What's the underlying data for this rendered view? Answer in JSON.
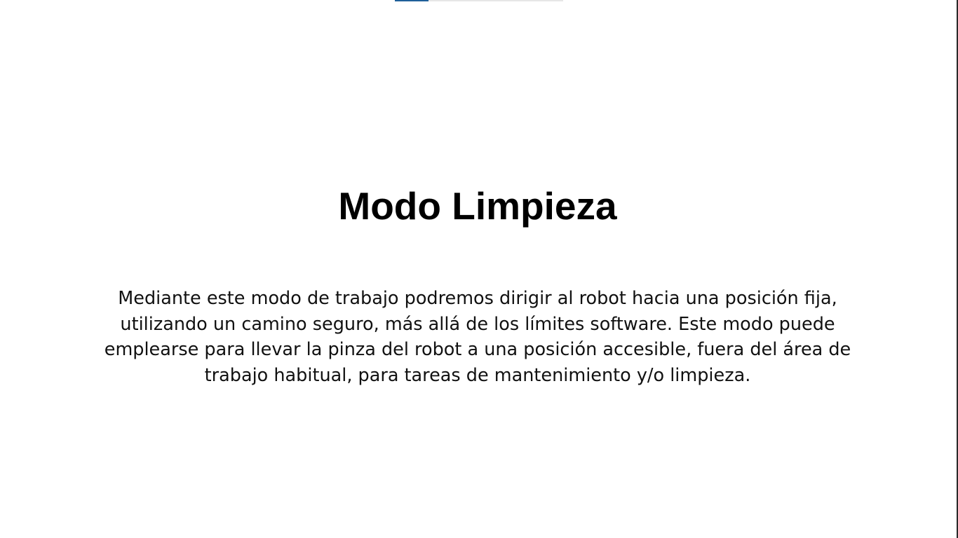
{
  "slide": {
    "title": "Modo Limpieza",
    "body": "Mediante este modo de trabajo podremos dirigir al robot hacia una posición fija, utilizando un camino seguro, más allá de los límites software. Este modo puede emplearse para llevar la pinza del robot a una posición accesible, fuera del área de trabajo habitual, para tareas de mantenimiento y/o limpieza."
  },
  "progress": {
    "fraction": 0.2,
    "fill_color": "#1f5f99",
    "track_color": "#e6e6e6"
  }
}
